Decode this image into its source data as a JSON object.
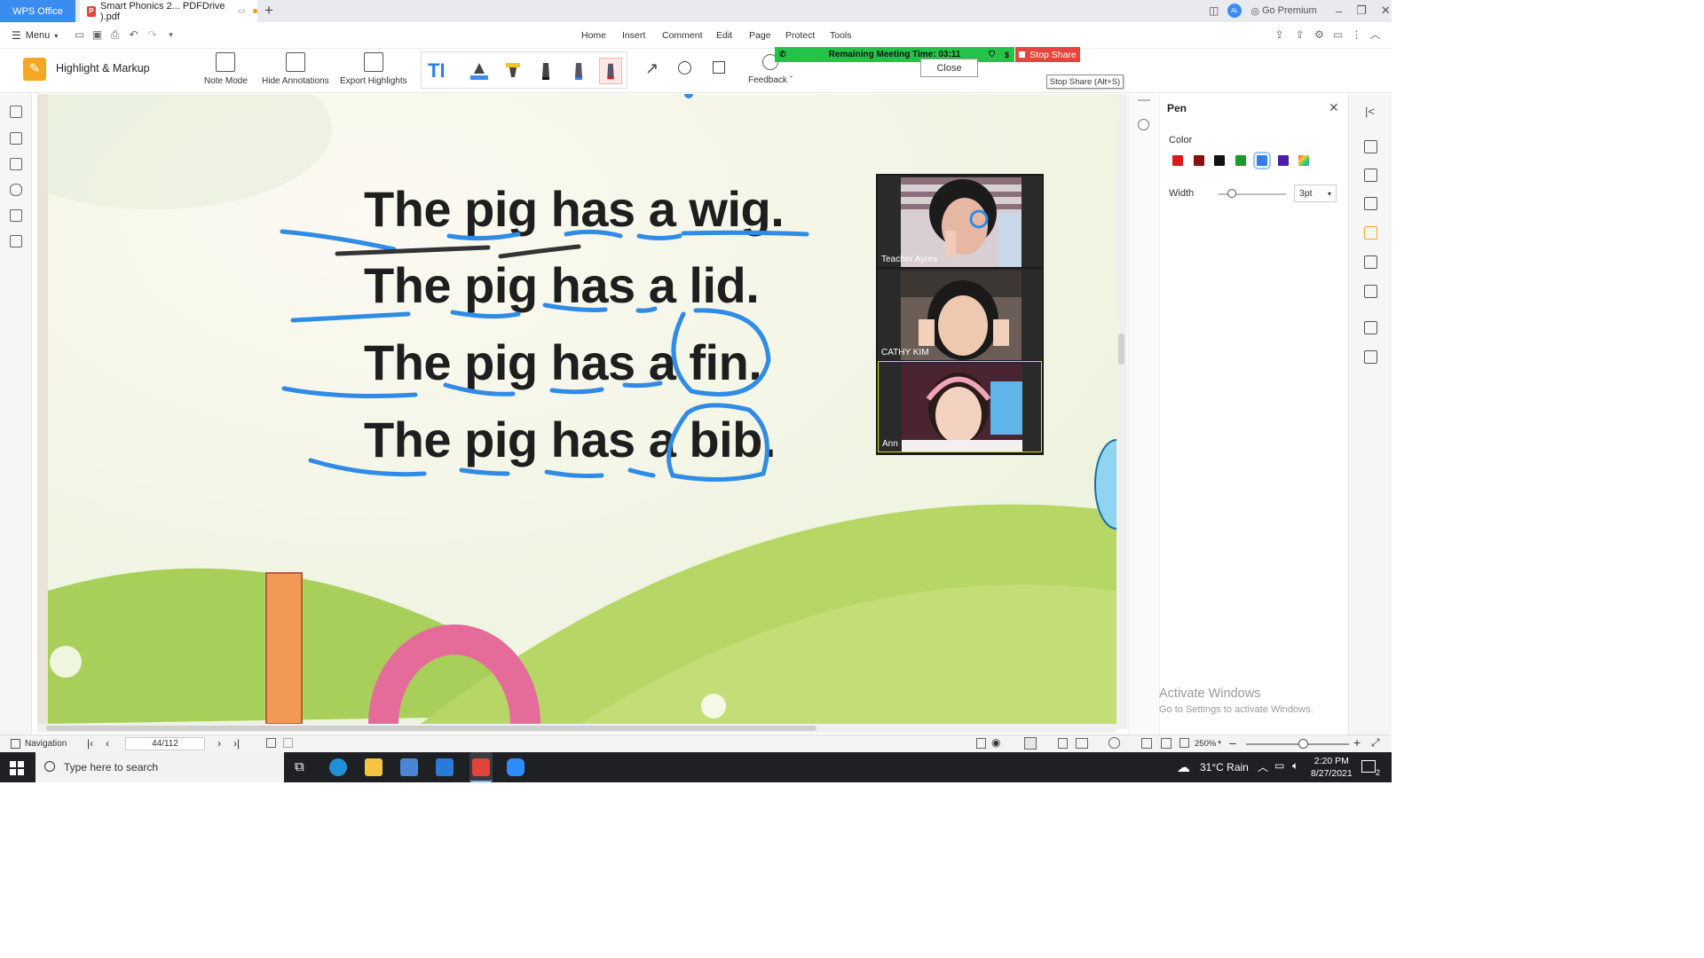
{
  "titlebar": {
    "app_tab": "WPS Office",
    "doc_tab": "Smart Phonics 2... PDFDrive ).pdf",
    "go_premium": "Go Premium",
    "avatar_initials": "AL"
  },
  "menubar": {
    "menu_label": "Menu",
    "tabs": [
      "Home",
      "Insert",
      "Comment",
      "Edit",
      "Page",
      "Protect",
      "Tools"
    ]
  },
  "ribbon": {
    "mode_title": "Highlight & Markup",
    "buttons": [
      "Note Mode",
      "Hide Annotations",
      "Export Highlights"
    ],
    "feedback": "Feedback ˇ"
  },
  "meeting": {
    "remaining_time": "Remaining Meeting Time: 03:11",
    "stop_share": "Stop Share",
    "stop_share_tooltip": "Stop Share (Alt+S)",
    "close_label": "Close"
  },
  "document": {
    "sentences": [
      "The pig has a wig.",
      "The pig has a lid.",
      "The pig has a fin.",
      "The pig has a bib."
    ]
  },
  "participants": [
    "Teacher Ayres",
    "CATHY KIM",
    "Ann"
  ],
  "pen_panel": {
    "title": "Pen",
    "color_label": "Color",
    "width_label": "Width",
    "width_value": "3pt",
    "colors": [
      "#e3141b",
      "#8b0f10",
      "#111111",
      "#1a9a2c",
      "#2f7fe8",
      "#4b1ea8",
      "multicolor"
    ],
    "selected_color": "#2f7fe8",
    "width_fraction": 0.2
  },
  "watermark": {
    "line1": "Activate Windows",
    "line2": "Go to Settings to activate Windows."
  },
  "statusbar": {
    "navigation": "Navigation",
    "page_indicator": "44/112",
    "zoom": "250%",
    "zoom_fraction": 0.55
  },
  "taskbar": {
    "search_placeholder": "Type here to search",
    "weather": "31°C  Rain",
    "time": "2:20 PM",
    "date": "8/27/2021",
    "notification_count": "2"
  },
  "colors": {
    "accent": "#3a8cf0",
    "pen_blue": "#2f8be6",
    "meeting_green": "#23c34a",
    "stop_red": "#e8433c"
  }
}
